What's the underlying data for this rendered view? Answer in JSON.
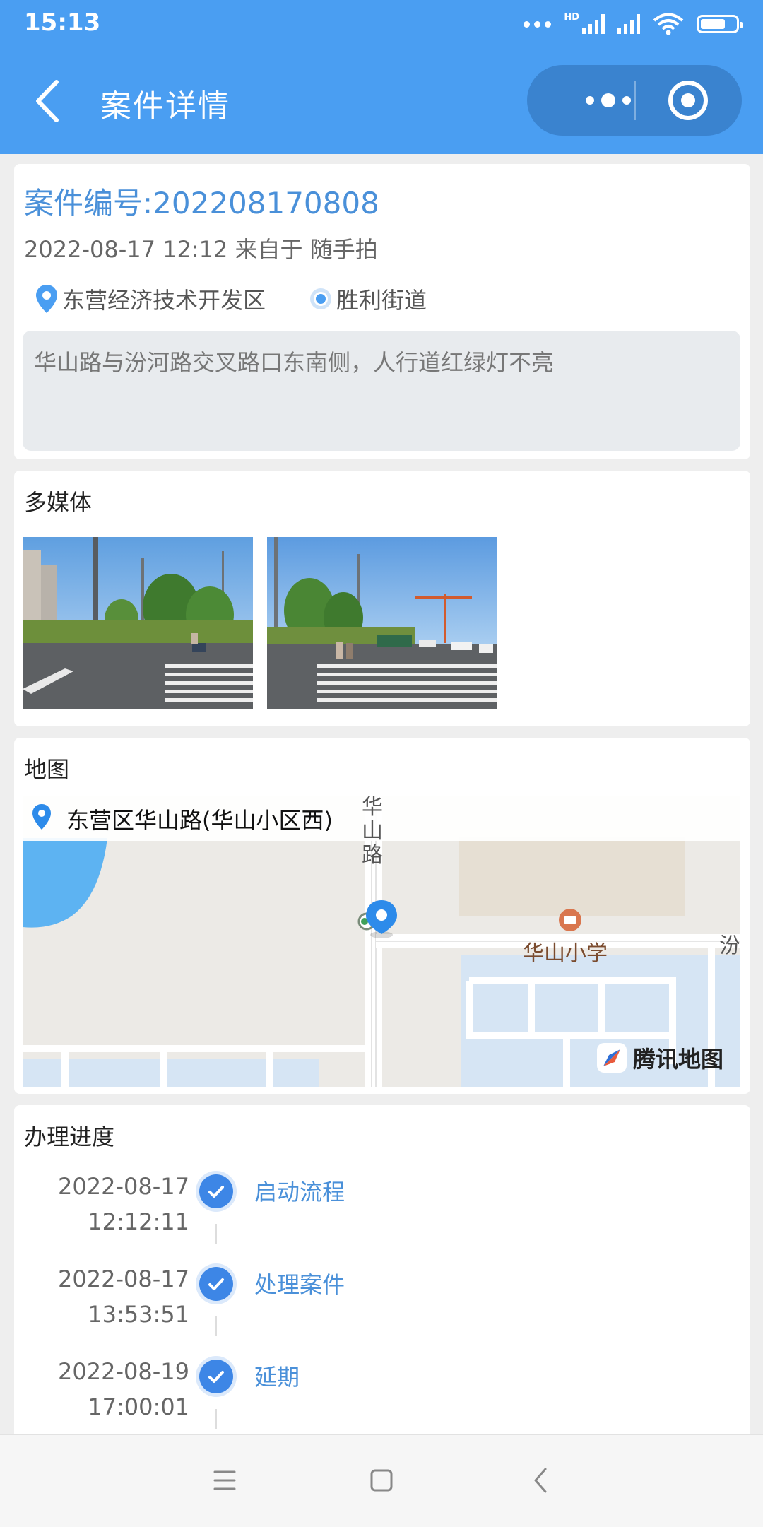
{
  "status_bar": {
    "time": "15:13",
    "network": "HD"
  },
  "header": {
    "title": "案件详情"
  },
  "case": {
    "number": "案件编号:202208170808",
    "meta": "2022-08-17 12:12 来自于 随手拍",
    "district": "东营经济技术开发区",
    "street": "胜利街道",
    "description": "华山路与汾河路交叉路口东南侧，人行道红绿灯不亮"
  },
  "media": {
    "title": "多媒体",
    "photos": [
      "crosswalk-photo-1",
      "crosswalk-photo-2"
    ]
  },
  "map": {
    "title": "地图",
    "address": "东营区华山路(华山小区西)",
    "road_vertical": "华山路",
    "school": "华山小学",
    "road_edge": "汾",
    "provider": "腾讯地图"
  },
  "progress": {
    "title": "办理进度",
    "steps": [
      {
        "date": "2022-08-17",
        "time": "12:12:11",
        "label": "启动流程"
      },
      {
        "date": "2022-08-17",
        "time": "13:53:51",
        "label": "处理案件"
      },
      {
        "date": "2022-08-19",
        "time": "17:00:01",
        "label": "延期"
      }
    ]
  },
  "colors": {
    "header_bg": "#4a9ef2",
    "accent": "#4a90d9",
    "check": "#3d86e6"
  }
}
